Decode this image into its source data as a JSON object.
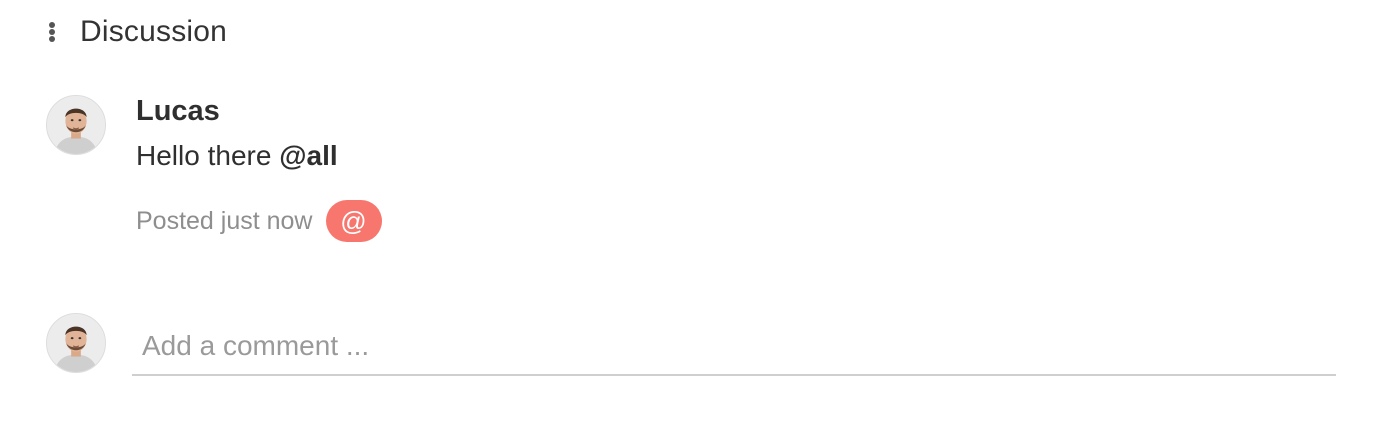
{
  "header": {
    "menu_icon": "vertical-ellipsis-icon",
    "title": "Discussion"
  },
  "comment": {
    "author": "Lucas",
    "text_prefix": "Hello there ",
    "mention": "@all",
    "posted": "Posted just now",
    "badge_symbol": "@",
    "badge_color": "#f7776e"
  },
  "composer": {
    "placeholder": "Add a comment ..."
  }
}
